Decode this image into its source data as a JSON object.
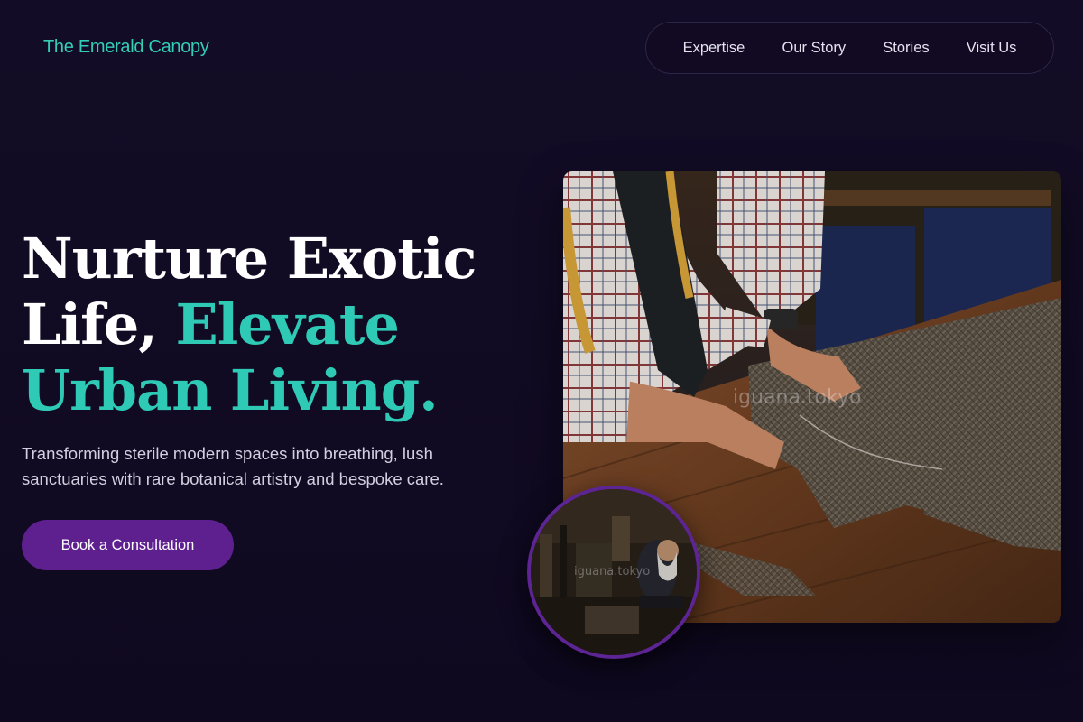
{
  "header": {
    "logo": "The Emerald Canopy",
    "nav": [
      "Expertise",
      "Our Story",
      "Stories",
      "Visit Us"
    ]
  },
  "hero": {
    "headline_line1": "Nurture Exotic",
    "headline_line2_plain": "Life, ",
    "headline_line2_accent": "Elevate",
    "headline_line3_accent": "Urban Living.",
    "subtitle": "Transforming sterile modern spaces into breathing, lush sanctuaries with rare botanical artistry and bespoke care.",
    "cta_label": "Book a Consultation"
  },
  "images": {
    "main_watermark": "iguana.tokyo",
    "inset_watermark": "iguana.tokyo"
  },
  "colors": {
    "background": "#120b24",
    "accent": "#2fcab6",
    "cta": "#5e1f8f",
    "inset_ring": "#5d2494"
  }
}
